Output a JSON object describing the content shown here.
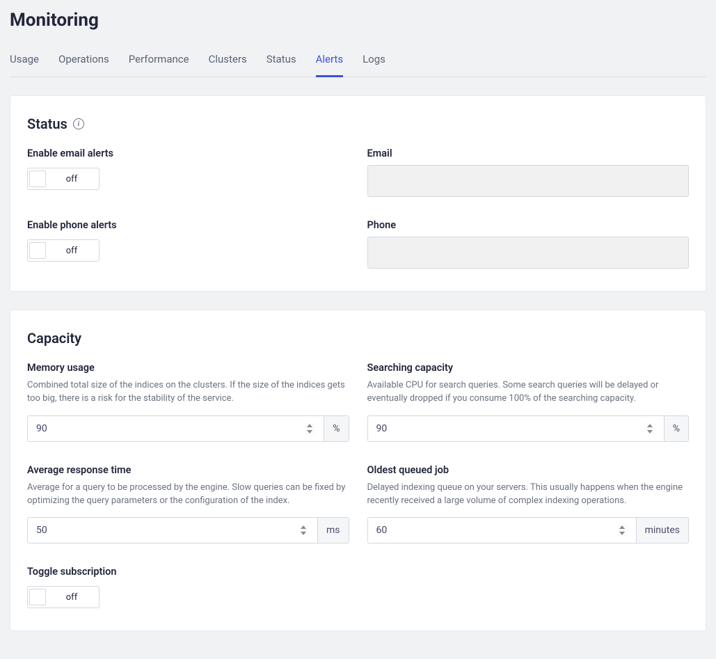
{
  "page_title": "Monitoring",
  "tabs": [
    {
      "label": "Usage",
      "active": false
    },
    {
      "label": "Operations",
      "active": false
    },
    {
      "label": "Performance",
      "active": false
    },
    {
      "label": "Clusters",
      "active": false
    },
    {
      "label": "Status",
      "active": false
    },
    {
      "label": "Alerts",
      "active": true
    },
    {
      "label": "Logs",
      "active": false
    }
  ],
  "status_card": {
    "title": "Status",
    "email_alerts": {
      "label": "Enable email alerts",
      "toggle": "off"
    },
    "email_field": {
      "label": "Email",
      "value": ""
    },
    "phone_alerts": {
      "label": "Enable phone alerts",
      "toggle": "off"
    },
    "phone_field": {
      "label": "Phone",
      "value": ""
    }
  },
  "capacity_card": {
    "title": "Capacity",
    "memory": {
      "label": "Memory usage",
      "desc": "Combined total size of the indices on the clusters. If the size of the indices gets too big, there is a risk for the stability of the service.",
      "value": "90",
      "unit": "%"
    },
    "searching": {
      "label": "Searching capacity",
      "desc": "Available CPU for search queries. Some search queries will be delayed or eventually dropped if you consume 100% of the searching capacity.",
      "value": "90",
      "unit": "%"
    },
    "response": {
      "label": "Average response time",
      "desc": "Average for a query to be processed by the engine. Slow queries can be fixed by optimizing the query parameters or the configuration of the index.",
      "value": "50",
      "unit": "ms"
    },
    "oldest": {
      "label": "Oldest queued job",
      "desc": "Delayed indexing queue on your servers. This usually happens when the engine recently received a large volume of complex indexing operations.",
      "value": "60",
      "unit": "minutes"
    },
    "toggle_sub": {
      "label": "Toggle subscription",
      "toggle": "off"
    }
  }
}
